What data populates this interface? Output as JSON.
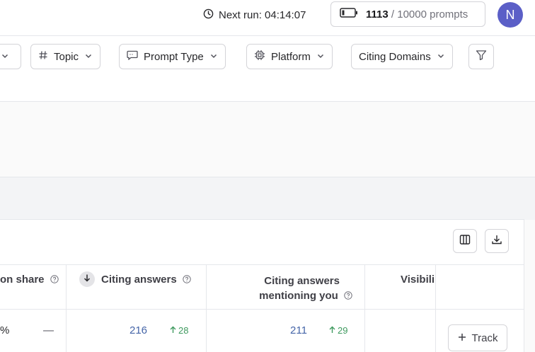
{
  "header": {
    "next_run_label": "Next run: 04:14:07",
    "quota_used": "1113",
    "quota_rest": "/ 10000 prompts",
    "avatar_initial": "N",
    "avatar_color": "#5b5fc7"
  },
  "filters": {
    "topic": "Topic",
    "prompt_type": "Prompt Type",
    "platform": "Platform",
    "citing_domains": "Citing Domains"
  },
  "table": {
    "columns": {
      "mention_share": "on share",
      "citing_answers": "Citing answers",
      "citing_mentioning_line1": "Citing answers",
      "citing_mentioning_line2": "mentioning you",
      "visibility": "Visibili"
    },
    "row": {
      "mention_share_value": "%",
      "mention_share_delta": "—",
      "citing_answers_value": "216",
      "citing_answers_delta": "28",
      "citing_mentioning_value": "211",
      "citing_mentioning_delta": "29"
    }
  },
  "actions": {
    "track_label": "Track"
  },
  "colors": {
    "accent_link": "#4565a8",
    "positive": "#3f9a5f"
  }
}
